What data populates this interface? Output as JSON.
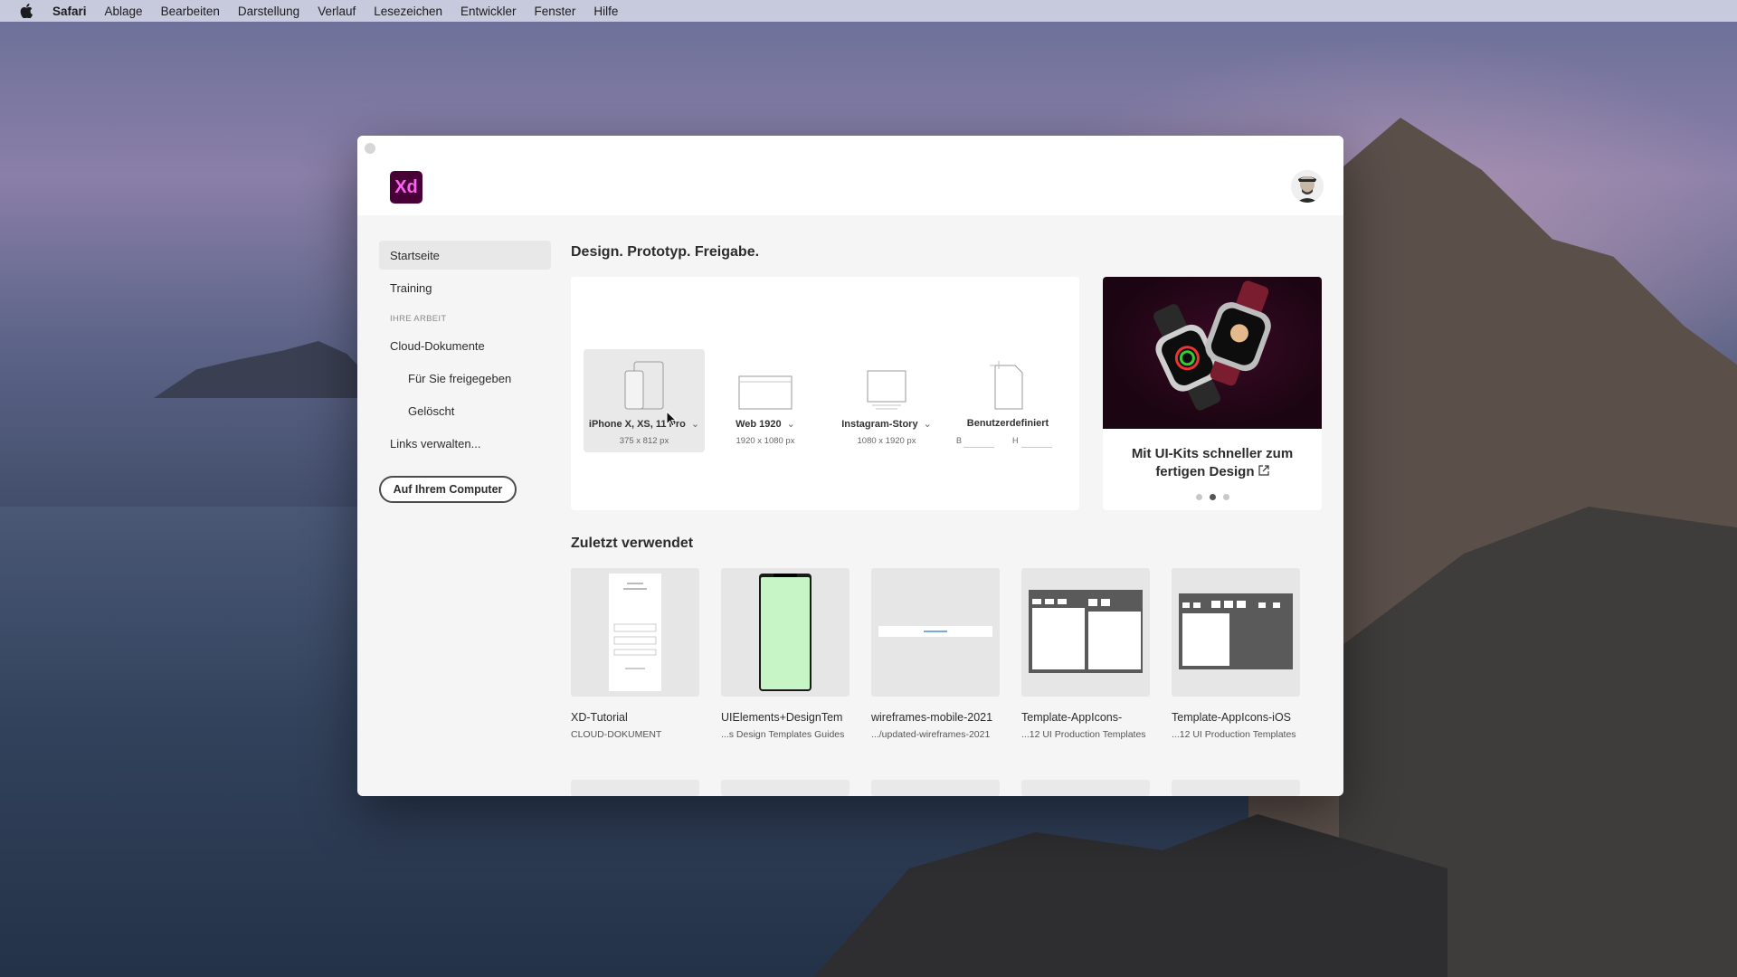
{
  "menubar": {
    "apple_icon": "apple-icon",
    "items": [
      "Safari",
      "Ablage",
      "Bearbeiten",
      "Darstellung",
      "Verlauf",
      "Lesezeichen",
      "Entwickler",
      "Fenster",
      "Hilfe"
    ]
  },
  "app": {
    "logo_text": "Xd",
    "brand_color": "#470137",
    "brand_accent": "#ff61f6"
  },
  "sidebar": {
    "home": "Startseite",
    "training": "Training",
    "section_heading": "IHRE ARBEIT",
    "cloud_docs": "Cloud-Dokumente",
    "shared": "Für Sie freigegeben",
    "deleted": "Gelöscht",
    "manage_links": "Links verwalten...",
    "on_computer_button": "Auf Ihrem Computer"
  },
  "main": {
    "title": "Design. Prototyp. Freigabe.",
    "presets": [
      {
        "name": "iPhone X, XS, 11 Pro",
        "size": "375 x 812 px"
      },
      {
        "name": "Web 1920",
        "size": "1920 x 1080 px"
      },
      {
        "name": "Instagram-Story",
        "size": "1080 x 1920 px"
      },
      {
        "name": "Benutzerdefiniert",
        "width_label": "B",
        "height_label": "H"
      }
    ],
    "promo": {
      "text": "Mit UI-Kits schneller zum fertigen Design",
      "external_icon": "external-link-icon",
      "dots_count": 3,
      "active_dot": 2
    },
    "recent_title": "Zuletzt verwendet",
    "recent": [
      {
        "name": "XD-Tutorial",
        "path": "CLOUD-DOKUMENT"
      },
      {
        "name": "UIElements+DesignTem",
        "path": "...s Design Templates Guides"
      },
      {
        "name": "wireframes-mobile-2021",
        "path": ".../updated-wireframes-2021"
      },
      {
        "name": "Template-AppIcons-",
        "path": "...12 UI Production Templates"
      },
      {
        "name": "Template-AppIcons-iOS",
        "path": "...12 UI Production Templates"
      }
    ]
  }
}
